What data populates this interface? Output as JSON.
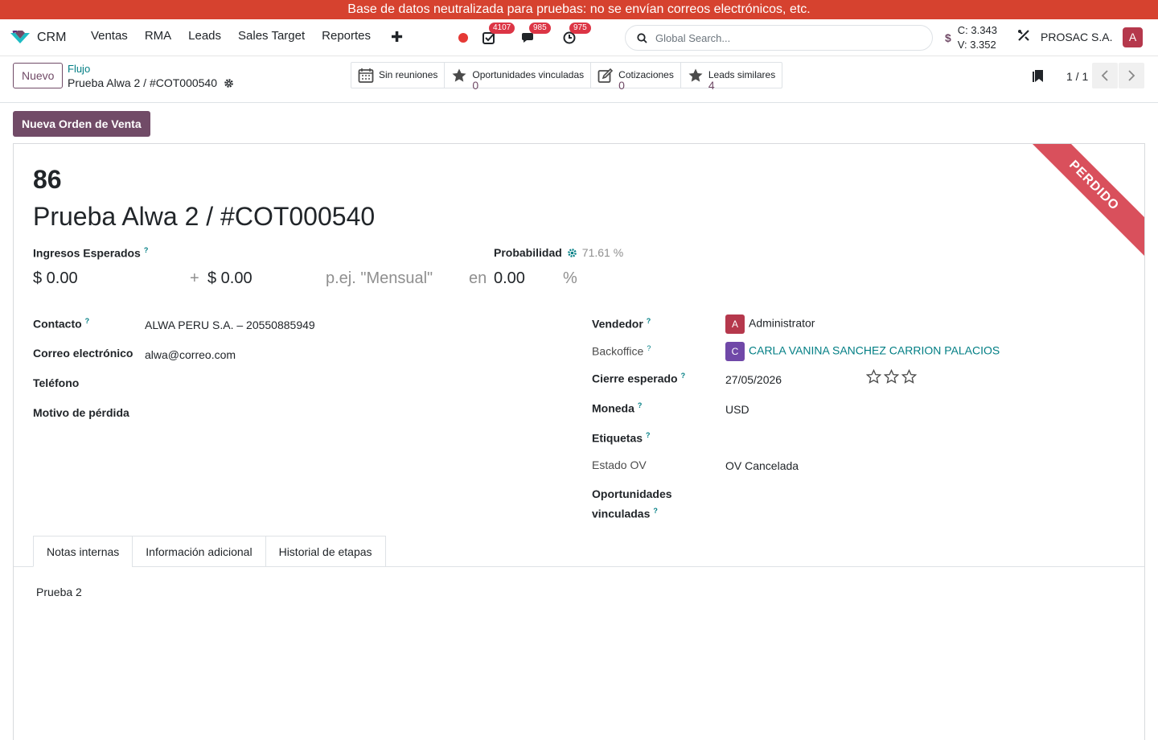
{
  "banner": "Base de datos neutralizada para pruebas: no se envían correos electrónicos, etc.",
  "navbar": {
    "app_name": "CRM",
    "menu": [
      "Ventas",
      "RMA",
      "Leads",
      "Sales Target",
      "Reportes"
    ],
    "badges": {
      "activities": "4107",
      "messages": "985",
      "clock": "975"
    },
    "search_placeholder": "Global Search...",
    "rates": {
      "c": "C: 3.343",
      "v": "V: 3.352"
    },
    "company": "PROSAC S.A.",
    "user_initial": "A"
  },
  "control": {
    "new_label": "Nuevo",
    "breadcrumb_parent": "Flujo",
    "breadcrumb_current": "Prueba Alwa 2 / #COT000540",
    "smart_buttons": {
      "meetings": "Sin reuniones",
      "linked_label": "Oportunidades vinculadas",
      "linked_value": "0",
      "quotes_label": "Cotizaciones",
      "quotes_value": "0",
      "similar_label": "Leads similares",
      "similar_value": "4"
    },
    "pager": "1 / 1"
  },
  "actions": {
    "new_sale_order": "Nueva Orden de Venta"
  },
  "record": {
    "ribbon": "PERDIDO",
    "number": "86",
    "name": "Prueba Alwa 2 / #COT000540",
    "expected_revenue_label": "Ingresos Esperados",
    "probability_label": "Probabilidad",
    "probability_value": "71.61 %",
    "revenue": "$ 0.00",
    "plus": "+",
    "recurring": "$ 0.00",
    "recurring_placeholder": "p.ej. \"Mensual\"",
    "in": "en",
    "prob_input": "0.00",
    "percent": "%",
    "left_fields": {
      "contact_label": "Contacto",
      "contact_value": "ALWA PERU S.A. – 20550885949",
      "email_label": "Correo electrónico",
      "email_value": "alwa@correo.com",
      "phone_label": "Teléfono",
      "lost_reason_label": "Motivo de pérdida"
    },
    "right_fields": {
      "salesperson_label": "Vendedor",
      "salesperson_initial": "A",
      "salesperson_value": "Administrator",
      "backoffice_label": "Backoffice",
      "backoffice_initial": "C",
      "backoffice_value": "CARLA VANINA SANCHEZ CARRION PALACIOS",
      "close_label": "Cierre esperado",
      "close_value": "27/05/2026",
      "currency_label": "Moneda",
      "currency_value": "USD",
      "tags_label": "Etiquetas",
      "so_state_label": "Estado OV",
      "so_state_value": "OV Cancelada",
      "linked_label_1": "Oportunidades",
      "linked_label_2": "vinculadas"
    },
    "tabs": [
      "Notas internas",
      "Información adicional",
      "Historial de etapas"
    ],
    "note": "Prueba 2"
  },
  "colors": {
    "brand": "#714b67",
    "banner": "#d6422f",
    "ribbon": "#d9505c",
    "link": "#017e84"
  }
}
